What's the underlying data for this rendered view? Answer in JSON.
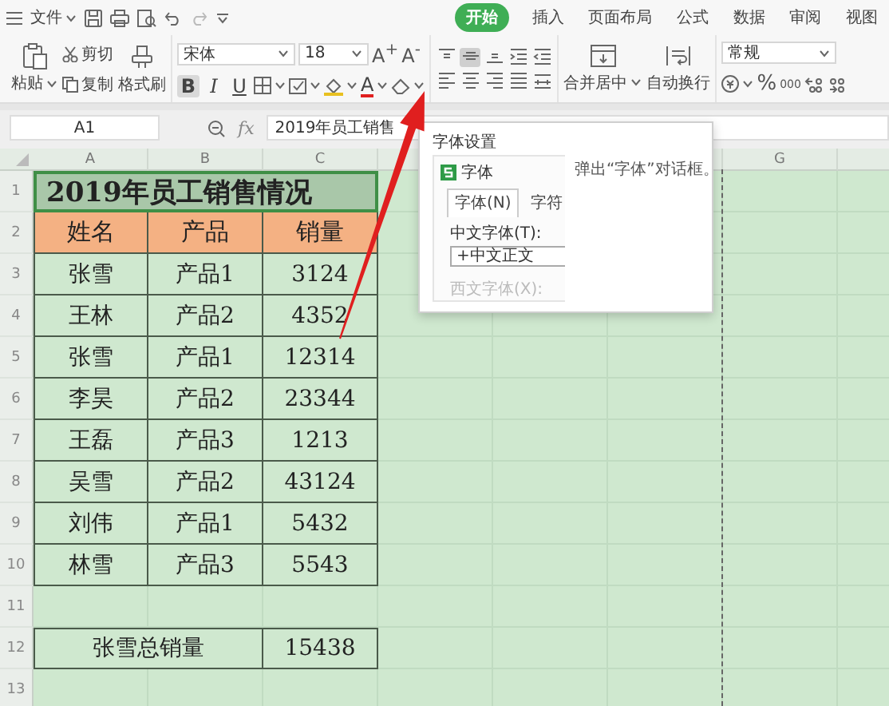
{
  "quick_access": {
    "menu_label": "文件"
  },
  "tabs": [
    {
      "label": "开始",
      "selected": true
    },
    {
      "label": "插入",
      "selected": false
    },
    {
      "label": "页面布局",
      "selected": false
    },
    {
      "label": "公式",
      "selected": false
    },
    {
      "label": "数据",
      "selected": false
    },
    {
      "label": "审阅",
      "selected": false
    },
    {
      "label": "视图",
      "selected": false
    }
  ],
  "ribbon": {
    "paste_label": "粘贴",
    "cut_label": "剪切",
    "copy_label": "复制",
    "format_painter_label": "格式刷",
    "font_name": "宋体",
    "font_size": "18",
    "size_buttons": [
      "A$^{+}$",
      "A$^{-}$"
    ],
    "format_buttons": [
      {
        "label": "B",
        "selected": true
      },
      {
        "label": "I",
        "selected": false
      },
      {
        "label": "U",
        "selected": false
      }
    ],
    "font_color_label": "A",
    "align_buttons": [
      {
        "kind": "top",
        "selected": false
      },
      {
        "kind": "middle",
        "selected": true
      },
      {
        "kind": "bottom",
        "selected": false
      },
      {
        "kind": "outdent",
        "selected": false
      },
      {
        "kind": "indent",
        "selected": false
      },
      {
        "kind": "left",
        "selected": false
      },
      {
        "kind": "center",
        "selected": false
      },
      {
        "kind": "right",
        "selected": false
      },
      {
        "kind": "justify",
        "selected": false
      },
      {
        "kind": "distributed",
        "selected": false
      }
    ],
    "merge_label": "合并居中",
    "wrap_label": "自动换行",
    "number_format": "常规",
    "percent_label": "%",
    "thousands_label": "000"
  },
  "formula_bar": {
    "cell_ref": "A1",
    "function_label": "fx",
    "formula": "2019年员工销售"
  },
  "sheet": {
    "column_headers_left": [
      "A",
      "B",
      "C"
    ],
    "column_headers_right": [
      "G"
    ],
    "row_numbers": [
      "1",
      "2",
      "3",
      "4",
      "5",
      "6",
      "7",
      "8",
      "9",
      "10",
      "11",
      "12",
      "13"
    ],
    "title": "2019年员工销售情况",
    "title_selected": true,
    "header": [
      "姓名",
      "产品",
      "销量"
    ],
    "rows": [
      [
        "张雪",
        "产品1",
        "3124"
      ],
      [
        "王林",
        "产品2",
        "4352"
      ],
      [
        "张雪",
        "产品1",
        "12314"
      ],
      [
        "李昊",
        "产品2",
        "23344"
      ],
      [
        "王磊",
        "产品3",
        "1213"
      ],
      [
        "吴雪",
        "产品2",
        "43124"
      ],
      [
        "刘伟",
        "产品1",
        "5432"
      ],
      [
        "林雪",
        "产品3",
        "5543"
      ]
    ],
    "total": {
      "label": "张雪总销量",
      "value": "15438"
    }
  },
  "tooltip": {
    "title": "字体设置",
    "description": "弹出“字体”对话框。",
    "preview": {
      "dialog_title": "字体",
      "tabs": [
        {
          "label": "字体(N)",
          "selected": true
        },
        {
          "label": "字符",
          "selected": false
        }
      ],
      "field_label": "中文字体(T):",
      "field_value": "+中文正文",
      "faded_label": "西文字体(X):"
    }
  }
}
